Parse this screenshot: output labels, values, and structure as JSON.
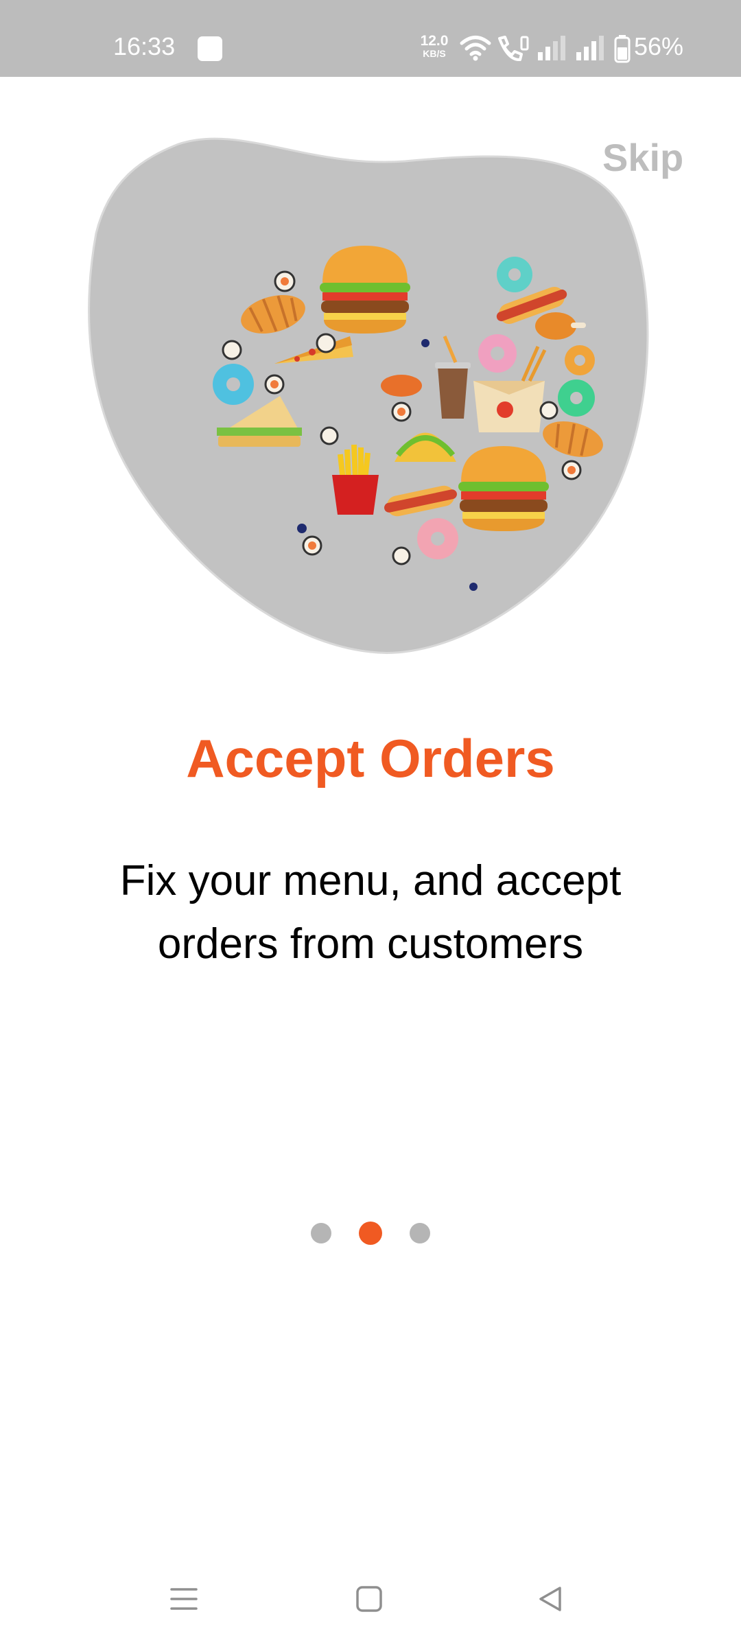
{
  "status_bar": {
    "time": "16:33",
    "network_speed_value": "12.0",
    "network_speed_unit": "KB/S",
    "battery_percent": "56%"
  },
  "onboarding": {
    "skip_label": "Skip",
    "title": "Accept Orders",
    "subtitle": "Fix your menu, and accept orders from customers",
    "page_count": 3,
    "current_page": 2
  },
  "colors": {
    "accent": "#f05a22",
    "blob": "#c2c2c2",
    "status_bar": "#bcbcbc",
    "inactive_dot": "#b5b5b5"
  },
  "icons": [
    "wifi-icon",
    "call-icon",
    "signal-icon",
    "battery-icon",
    "menu-icon",
    "home-icon",
    "back-icon"
  ]
}
